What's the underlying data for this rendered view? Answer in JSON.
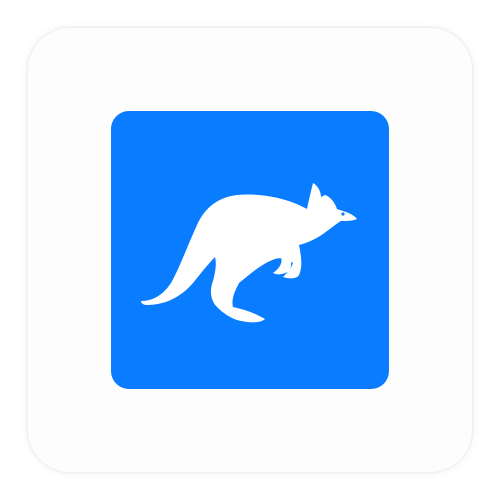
{
  "icon": {
    "symbol": "kangaroo-icon",
    "tile_color": "#0A7CFF",
    "symbol_color": "#FFFFFF",
    "card_color": "#FDFDFD"
  }
}
